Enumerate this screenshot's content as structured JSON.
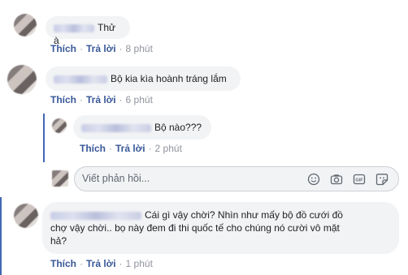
{
  "comments": [
    {
      "text": "Thử à",
      "actions": {
        "like": "Thích",
        "reply": "Trả lời",
        "time": "8 phút"
      }
    },
    {
      "text": "Bộ kia kìa hoành tráng lắm",
      "actions": {
        "like": "Thích",
        "reply": "Trả lời",
        "time": "6 phút"
      }
    },
    {
      "text": "Bộ nào???",
      "actions": {
        "like": "Thích",
        "reply": "Trả lời",
        "time": "2 phút"
      }
    },
    {
      "text_lines": [
        "Cái gì vậy chời? Nhìn như mấy bộ đồ cưới đồ",
        "chợ vậy chời.. bọ này đem đi thi quốc tế cho chúng nó cười vô mặt",
        "hả?"
      ],
      "actions": {
        "like": "Thích",
        "reply": "Trả lời",
        "time": "1 phút"
      }
    }
  ],
  "separator": "·",
  "reply_input": {
    "placeholder": "Viết phản hồi...",
    "icons": [
      "emoji-icon",
      "camera-icon",
      "gif-icon",
      "sticker-icon"
    ],
    "gif_label": "GIF"
  },
  "colors": {
    "link": "#385898",
    "bubble": "#f2f3f5",
    "thread_line": "#4267b2"
  }
}
